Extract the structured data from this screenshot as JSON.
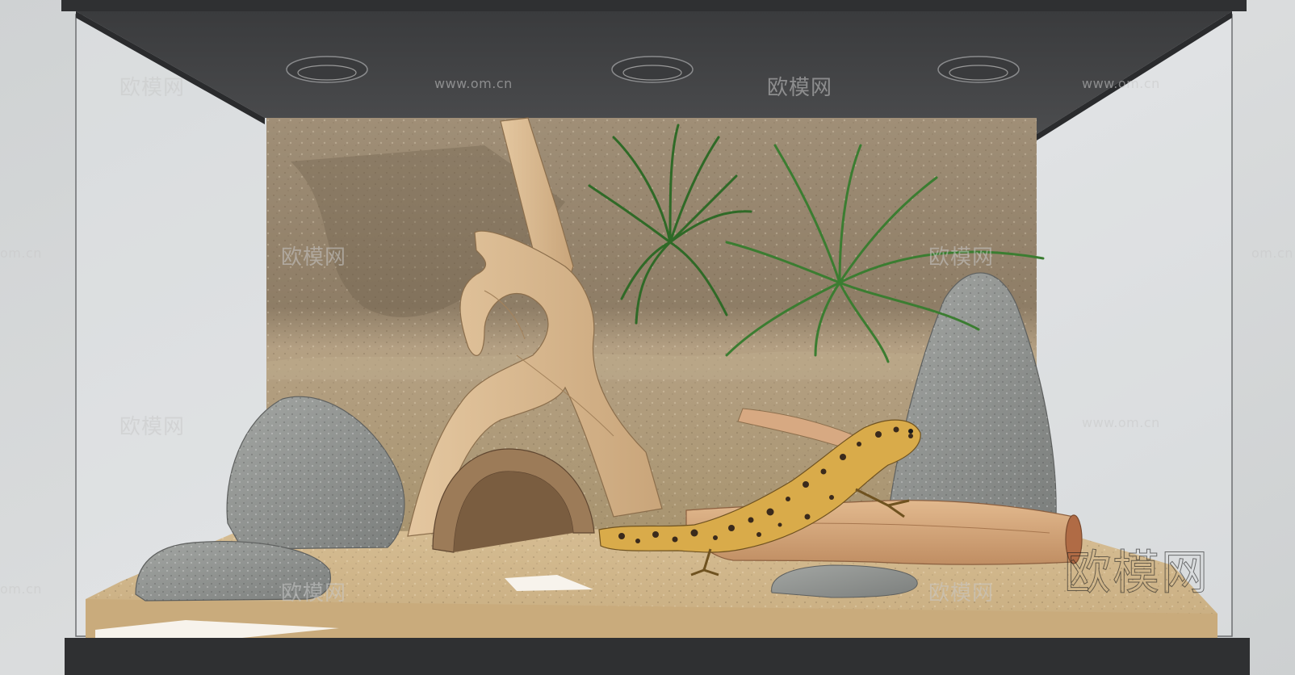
{
  "scene": {
    "subject": "terrarium",
    "colors": {
      "background": "#d4d6d7",
      "frame": "#3c3d3f",
      "rock_wall": "#9c8a70",
      "sand": "#cfb48a",
      "driftwood": "#d9b88f",
      "stone": "#8f9290",
      "plant": "#3f7f34",
      "gecko": "#d7a94a"
    }
  },
  "watermarks": {
    "brand": "欧模网",
    "url": "www.om.cn",
    "url_short": "om.cn"
  }
}
